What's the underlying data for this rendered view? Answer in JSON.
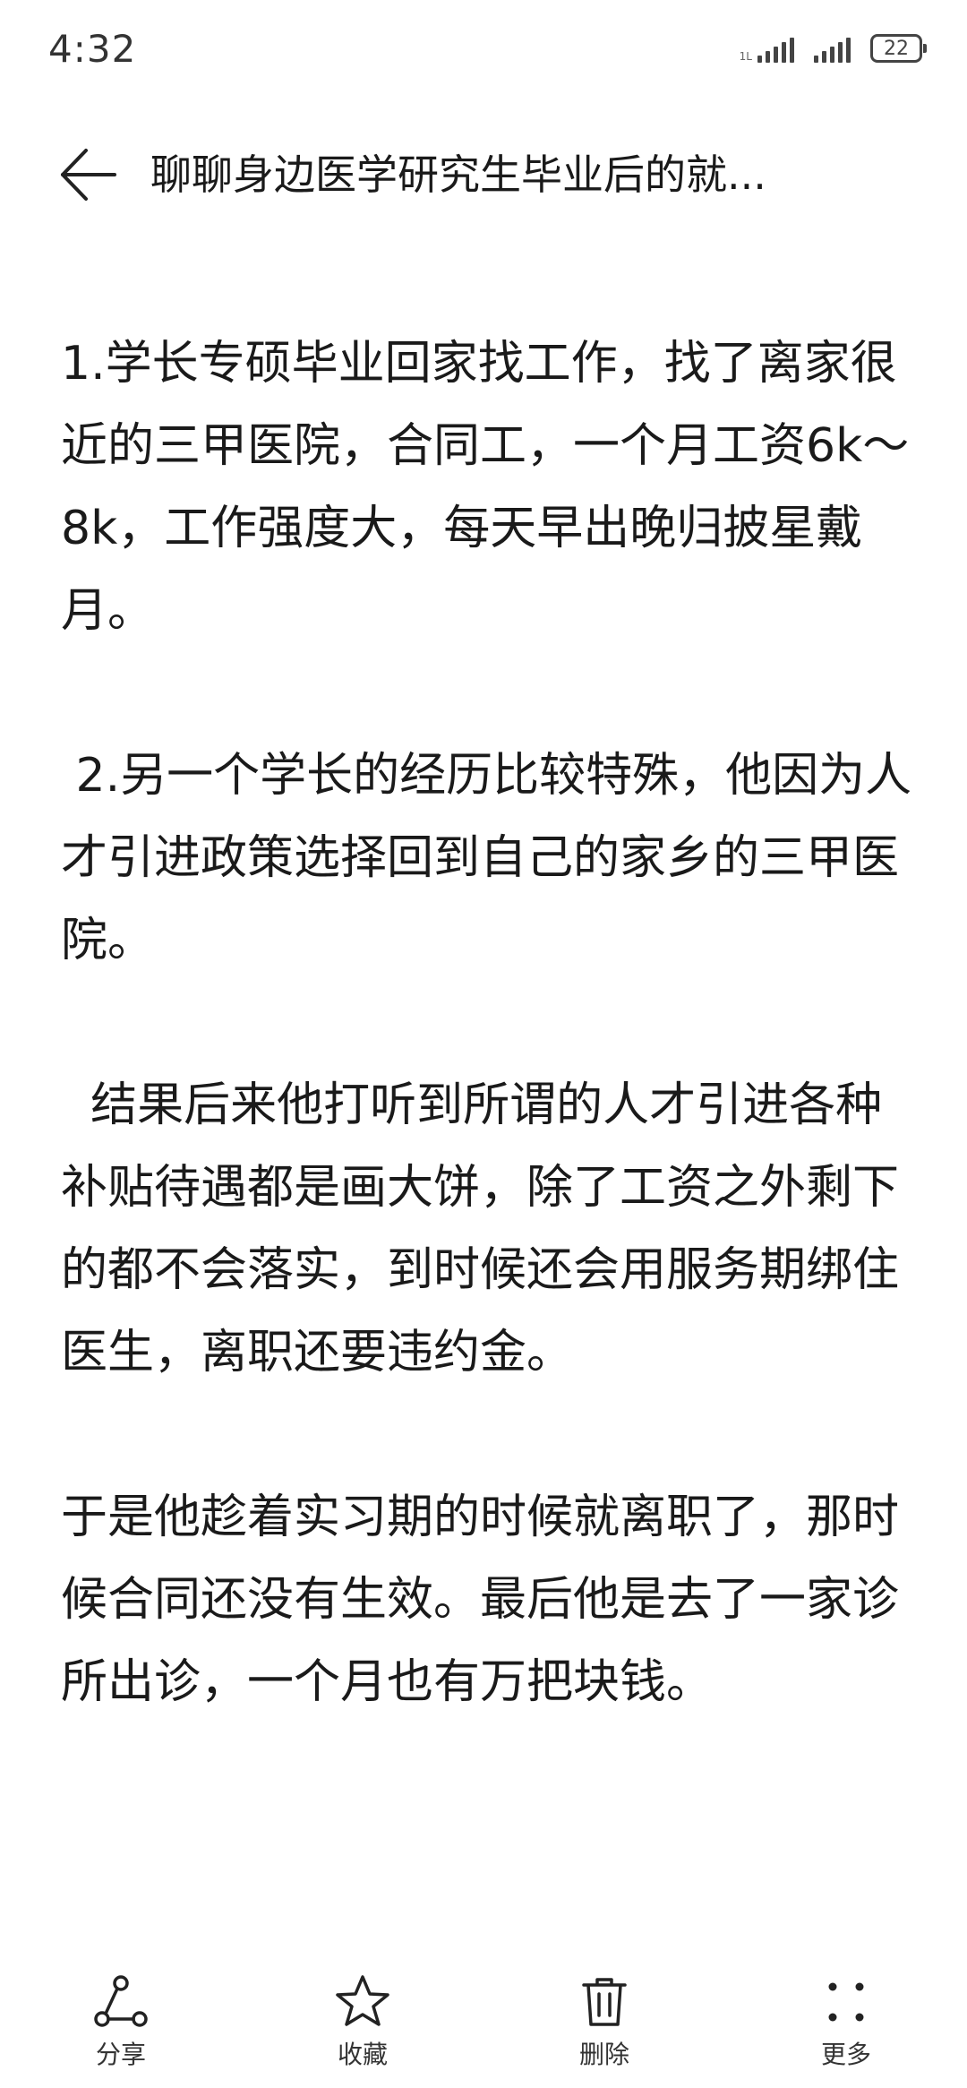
{
  "status_bar": {
    "time": "4:32",
    "battery": "22",
    "signal_tag": "1L"
  },
  "header": {
    "title": "聊聊身边医学研究生毕业后的就..."
  },
  "article": {
    "paragraphs": [
      "1.学长专硕毕业回家找工作，找了离家很近的三甲医院，合同工，一个月工资6k～8k，工作强度大，每天早出晚归披星戴月。",
      " 2.另一个学长的经历比较特殊，他因为人才引进政策选择回到自己的家乡的三甲医院。",
      "  结果后来他打听到所谓的人才引进各种补贴待遇都是画大饼，除了工资之外剩下的都不会落实，到时候还会用服务期绑住医生，离职还要违约金。",
      "于是他趁着实习期的时候就离职了，那时候合同还没有生效。最后他是去了一家诊所出诊，一个月也有万把块钱。"
    ]
  },
  "toolbar": {
    "share": "分享",
    "favorite": "收藏",
    "delete": "删除",
    "more": "更多"
  }
}
